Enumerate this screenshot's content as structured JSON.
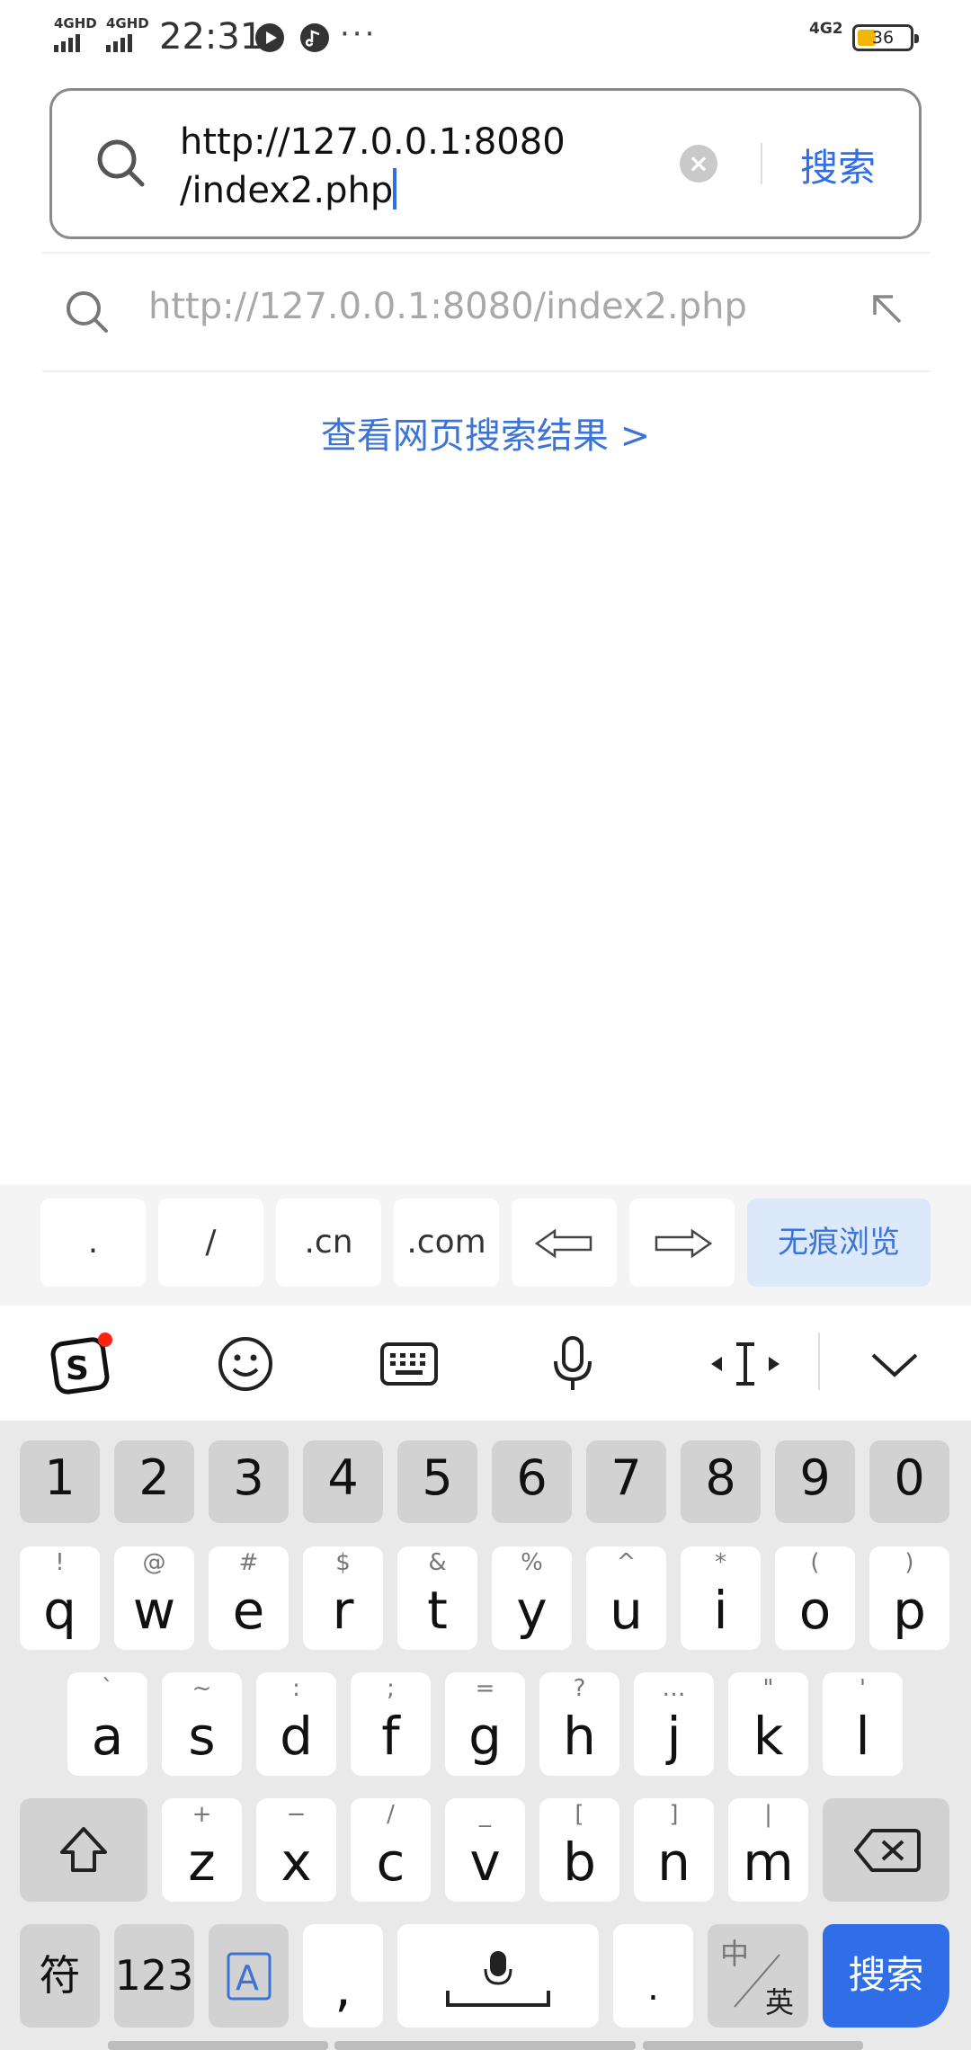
{
  "status_bar": {
    "sim1": "4GHD",
    "sim2": "4GHD",
    "time": "22:31",
    "more": "···",
    "network": "4G2",
    "battery": "36"
  },
  "search": {
    "url_line1": "http://127.0.0.1:8080",
    "url_line2": "/index2.php",
    "clear_icon": "clear-icon",
    "submit_label": "搜索"
  },
  "suggestion": {
    "text": "http://127.0.0.1:8080/index2.php",
    "fill_icon": "arrow-up-left-icon"
  },
  "web_results_link": "查看网页搜索结果 >",
  "keyboard": {
    "shortcuts": [
      ".",
      "/",
      ".cn",
      ".com",
      "⇦",
      "⇨",
      "无痕浏览"
    ],
    "toolbar_icons": [
      "sogou-logo-icon",
      "emoji-icon",
      "keyboard-icon",
      "microphone-icon",
      "cursor-move-icon",
      "collapse-icon"
    ],
    "numbers": [
      "1",
      "2",
      "3",
      "4",
      "5",
      "6",
      "7",
      "8",
      "9",
      "0"
    ],
    "row1": [
      {
        "sup": "!",
        "key": "q"
      },
      {
        "sup": "@",
        "key": "w"
      },
      {
        "sup": "#",
        "key": "e"
      },
      {
        "sup": "$",
        "key": "r"
      },
      {
        "sup": "&",
        "key": "t"
      },
      {
        "sup": "%",
        "key": "y"
      },
      {
        "sup": "^",
        "key": "u"
      },
      {
        "sup": "*",
        "key": "i"
      },
      {
        "sup": "(",
        "key": "o"
      },
      {
        "sup": ")",
        "key": "p"
      }
    ],
    "row2": [
      {
        "sup": "`",
        "key": "a"
      },
      {
        "sup": "~",
        "key": "s"
      },
      {
        "sup": ":",
        "key": "d"
      },
      {
        "sup": ";",
        "key": "f"
      },
      {
        "sup": "=",
        "key": "g"
      },
      {
        "sup": "?",
        "key": "h"
      },
      {
        "sup": "…",
        "key": "j"
      },
      {
        "sup": "\"",
        "key": "k"
      },
      {
        "sup": "'",
        "key": "l"
      }
    ],
    "row3": [
      {
        "sup": "+",
        "key": "z"
      },
      {
        "sup": "−",
        "key": "x"
      },
      {
        "sup": "/",
        "key": "c"
      },
      {
        "sup": "_",
        "key": "v"
      },
      {
        "sup": "[",
        "key": "b"
      },
      {
        "sup": "]",
        "key": "n"
      },
      {
        "sup": "|",
        "key": "m"
      }
    ],
    "bottom": {
      "symbols": "符",
      "numeric": "123",
      "comma": ",",
      "period": ".",
      "lang_cn": "中",
      "lang_en": "英",
      "search": "搜索"
    },
    "accent_color": "#2f6ee6"
  }
}
